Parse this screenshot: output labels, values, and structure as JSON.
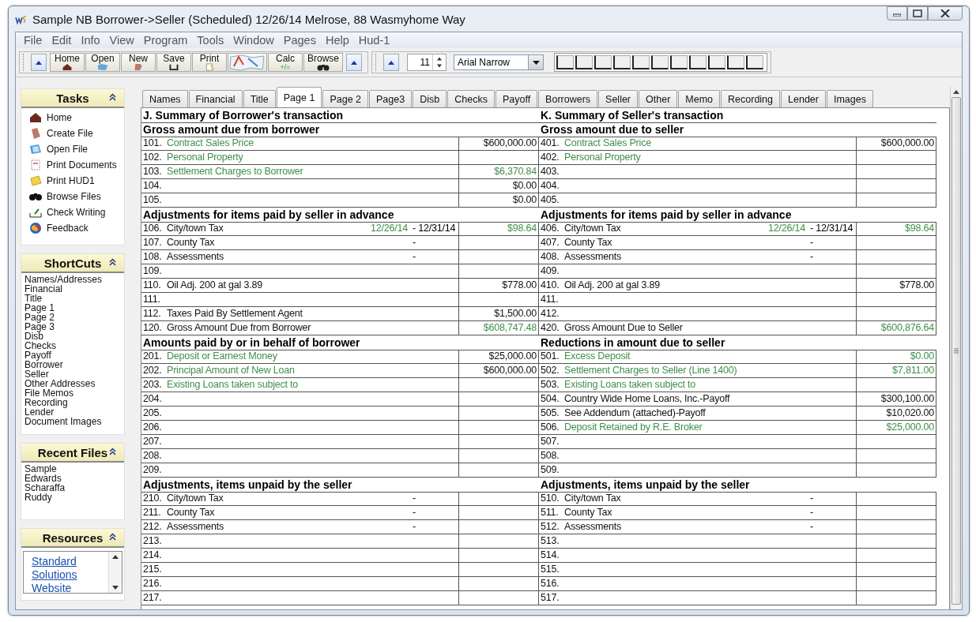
{
  "window": {
    "title": "Sample NB Borrower->Seller (Scheduled) 12/26/14 Melrose, 88 Wasmyhome Way"
  },
  "menu": [
    "File",
    "Edit",
    "Info",
    "View",
    "Program",
    "Tools",
    "Window",
    "Pages",
    "Help",
    "Hud-1"
  ],
  "toolbar": {
    "buttons": [
      {
        "kind": "home",
        "label": "Home"
      },
      {
        "kind": "open",
        "label": "Open"
      },
      {
        "kind": "new",
        "label": "New"
      },
      {
        "kind": "save",
        "label": "Save"
      },
      {
        "kind": "print",
        "label": "Print"
      },
      {
        "kind": "map"
      },
      {
        "kind": "calc",
        "label": "Calc",
        "glyph": "+/="
      },
      {
        "kind": "browse",
        "label": "Browse"
      }
    ],
    "font_size": "11",
    "font": "Arial Narrow"
  },
  "sidebar": [
    {
      "kind": "tasks",
      "title": "Tasks",
      "items": [
        {
          "kind": "house",
          "label": "Home"
        },
        {
          "kind": "file",
          "label": "Create File"
        },
        {
          "kind": "folder",
          "label": "Open File"
        },
        {
          "kind": "docs",
          "label": "Print Documents"
        },
        {
          "kind": "printer",
          "label": "Print HUD1"
        },
        {
          "kind": "binoculars",
          "label": "Browse Files"
        },
        {
          "kind": "check",
          "label": "Check Writing"
        },
        {
          "kind": "globe",
          "label": "Feedback"
        }
      ]
    },
    {
      "kind": "list",
      "title": "ShortCuts",
      "items": [
        {
          "label": "Names/Addresses"
        },
        {
          "label": "Financial"
        },
        {
          "label": "Title"
        },
        {
          "label": "Page 1"
        },
        {
          "label": "Page 2"
        },
        {
          "label": "Page 3"
        },
        {
          "label": "Disb"
        },
        {
          "label": "Checks"
        },
        {
          "label": "Payoff"
        },
        {
          "label": "Borrower"
        },
        {
          "label": "Seller"
        },
        {
          "label": "Other Addresses"
        },
        {
          "label": "File Memos"
        },
        {
          "label": "Recording"
        },
        {
          "label": "Lender"
        },
        {
          "label": "Document Images"
        }
      ]
    },
    {
      "kind": "list",
      "title": "Recent Files",
      "items": [
        {
          "label": "Sample"
        },
        {
          "label": "Edwards"
        },
        {
          "label": "Scharaffa"
        },
        {
          "label": "Ruddy"
        }
      ]
    },
    {
      "kind": "links",
      "title": "Resources",
      "items": [
        {
          "label": "Standard"
        },
        {
          "label": "Solutions"
        },
        {
          "label": "Website"
        }
      ]
    }
  ],
  "tabs": [
    {
      "label": "Names",
      "selected": false
    },
    {
      "label": "Financial",
      "selected": false
    },
    {
      "label": "Title",
      "selected": false
    },
    {
      "label": "Page 1",
      "selected": true
    },
    {
      "label": "Page 2",
      "selected": false
    },
    {
      "label": "Page3",
      "selected": false
    },
    {
      "label": "Disb",
      "selected": false
    },
    {
      "label": "Checks",
      "selected": false
    },
    {
      "label": "Payoff",
      "selected": false
    },
    {
      "label": "Borrowers",
      "selected": false
    },
    {
      "label": "Seller",
      "selected": false
    },
    {
      "label": "Other",
      "selected": false
    },
    {
      "label": "Memo",
      "selected": false
    },
    {
      "label": "Recording",
      "selected": false
    },
    {
      "label": "Lender",
      "selected": false
    },
    {
      "label": "Images",
      "selected": false
    }
  ],
  "sheet": {
    "left_title": "J. Summary of Borrower's transaction",
    "right_title": "K. Summary of Seller's transaction",
    "sections": [
      {
        "left_heading": "Gross amount due from borrower",
        "right_heading": "Gross amount due to seller",
        "rows": [
          {
            "left": {
              "num": "101.",
              "label": "Contract Sales Price",
              "label_linked": true,
              "amount": "$600,000.00",
              "amount_linked": false
            },
            "right": {
              "num": "401.",
              "label": "Contract Sales Price",
              "label_linked": true,
              "amount": "$600,000.00",
              "amount_linked": false
            }
          },
          {
            "left": {
              "num": "102.",
              "label": "Personal Property",
              "label_linked": true
            },
            "right": {
              "num": "402.",
              "label": "Personal Property",
              "label_linked": true
            }
          },
          {
            "left": {
              "num": "103.",
              "label": "Settlement Charges to Borrower",
              "label_linked": true,
              "amount": "$6,370.84",
              "amount_linked": true
            },
            "right": {
              "num": "403."
            }
          },
          {
            "left": {
              "num": "104.",
              "amount": "$0.00",
              "amount_linked": false
            },
            "right": {
              "num": "404."
            }
          },
          {
            "left": {
              "num": "105.",
              "amount": "$0.00",
              "amount_linked": false
            },
            "right": {
              "num": "405."
            }
          }
        ]
      },
      {
        "left_heading": "Adjustments for items paid by seller in advance",
        "right_heading": "Adjustments for items paid by seller in advance",
        "rows": [
          {
            "left": {
              "num": "106.",
              "label": "City/town Tax",
              "label_linked": false,
              "date_start": "12/26/14",
              "date_end": "- 12/31/14",
              "amount": "$98.64",
              "amount_linked": true
            },
            "right": {
              "num": "406.",
              "label": "City/town Tax",
              "label_linked": false,
              "date_start": "12/26/14",
              "date_end": "- 12/31/14",
              "amount": "$98.64",
              "amount_linked": true
            }
          },
          {
            "left": {
              "num": "107.",
              "label": "County Tax",
              "label_linked": false,
              "date_end": "-"
            },
            "right": {
              "num": "407.",
              "label": "County Tax",
              "label_linked": false,
              "date_end": "-"
            }
          },
          {
            "left": {
              "num": "108.",
              "label": "Assessments",
              "label_linked": false,
              "date_end": "-"
            },
            "right": {
              "num": "408.",
              "label": "Assessments",
              "label_linked": false,
              "date_end": "-"
            }
          },
          {
            "left": {
              "num": "109."
            },
            "right": {
              "num": "409."
            }
          },
          {
            "left": {
              "num": "110.",
              "label": "Oil Adj. 200 at gal 3.89",
              "label_linked": false,
              "amount": "$778.00",
              "amount_linked": false
            },
            "right": {
              "num": "410.",
              "label": "Oil Adj. 200 at gal 3.89",
              "label_linked": false,
              "amount": "$778.00",
              "amount_linked": false
            }
          },
          {
            "left": {
              "num": "111."
            },
            "right": {
              "num": "411."
            }
          },
          {
            "left": {
              "num": "112.",
              "label": "Taxes Paid By Settlement Agent",
              "label_linked": false,
              "amount": "$1,500.00",
              "amount_linked": false
            },
            "right": {
              "num": "412."
            }
          },
          {
            "left": {
              "num": "120.",
              "label": "Gross Amount Due from Borrower",
              "label_linked": false,
              "amount": "$608,747.48",
              "amount_linked": true
            },
            "right": {
              "num": "420.",
              "label": "Gross Amount Due to Seller",
              "label_linked": false,
              "amount": "$600,876.64",
              "amount_linked": true
            }
          }
        ]
      },
      {
        "left_heading": "Amounts paid by or in behalf of borrower",
        "right_heading": "Reductions in amount due to seller",
        "rows": [
          {
            "left": {
              "num": "201.",
              "label": "Deposit or Earnest Money",
              "label_linked": true,
              "amount": "$25,000.00",
              "amount_linked": false
            },
            "right": {
              "num": "501.",
              "label": "Excess Deposit",
              "label_linked": true,
              "amount": "$0.00",
              "amount_linked": true
            }
          },
          {
            "left": {
              "num": "202.",
              "label": "Principal Amount of New Loan",
              "label_linked": true,
              "amount": "$600,000.00",
              "amount_linked": false
            },
            "right": {
              "num": "502.",
              "label": "Settlement Charges to Seller (Line 1400)",
              "label_linked": true,
              "amount": "$7,811.00",
              "amount_linked": true
            }
          },
          {
            "left": {
              "num": "203.",
              "label": "Existing Loans taken subject to",
              "label_linked": true
            },
            "right": {
              "num": "503.",
              "label": "Existing Loans taken subject to",
              "label_linked": true
            }
          },
          {
            "left": {
              "num": "204."
            },
            "right": {
              "num": "504.",
              "label": "Country Wide Home Loans, Inc.-Payoff",
              "label_linked": false,
              "amount": "$300,100.00",
              "amount_linked": false
            }
          },
          {
            "left": {
              "num": "205."
            },
            "right": {
              "num": "505.",
              "label": "See Addendum (attached)-Payoff",
              "label_linked": false,
              "amount": "$10,020.00",
              "amount_linked": false
            }
          },
          {
            "left": {
              "num": "206."
            },
            "right": {
              "num": "506.",
              "label": "Deposit Retained by R.E. Broker",
              "label_linked": true,
              "amount": "$25,000.00",
              "amount_linked": true
            }
          },
          {
            "left": {
              "num": "207."
            },
            "right": {
              "num": "507."
            }
          },
          {
            "left": {
              "num": "208."
            },
            "right": {
              "num": "508."
            }
          },
          {
            "left": {
              "num": "209."
            },
            "right": {
              "num": "509."
            }
          }
        ]
      },
      {
        "left_heading": "Adjustments, items unpaid by the seller",
        "right_heading": "Adjustments, items unpaid by the seller",
        "rows": [
          {
            "left": {
              "num": "210.",
              "label": "City/town Tax",
              "label_linked": false,
              "date_end": "-"
            },
            "right": {
              "num": "510.",
              "label": "City/town Tax",
              "label_linked": false,
              "date_end": "-"
            }
          },
          {
            "left": {
              "num": "211.",
              "label": "County Tax",
              "label_linked": false,
              "date_end": "-"
            },
            "right": {
              "num": "511.",
              "label": "County Tax",
              "label_linked": false,
              "date_end": "-"
            }
          },
          {
            "left": {
              "num": "212.",
              "label": "Assessments",
              "label_linked": false,
              "date_end": "-"
            },
            "right": {
              "num": "512.",
              "label": "Assessments",
              "label_linked": false,
              "date_end": "-"
            }
          },
          {
            "left": {
              "num": "213."
            },
            "right": {
              "num": "513."
            }
          },
          {
            "left": {
              "num": "214."
            },
            "right": {
              "num": "514."
            }
          },
          {
            "left": {
              "num": "215."
            },
            "right": {
              "num": "515."
            }
          },
          {
            "left": {
              "num": "216."
            },
            "right": {
              "num": "516."
            }
          },
          {
            "left": {
              "num": "217."
            },
            "right": {
              "num": "517."
            }
          }
        ]
      }
    ]
  }
}
